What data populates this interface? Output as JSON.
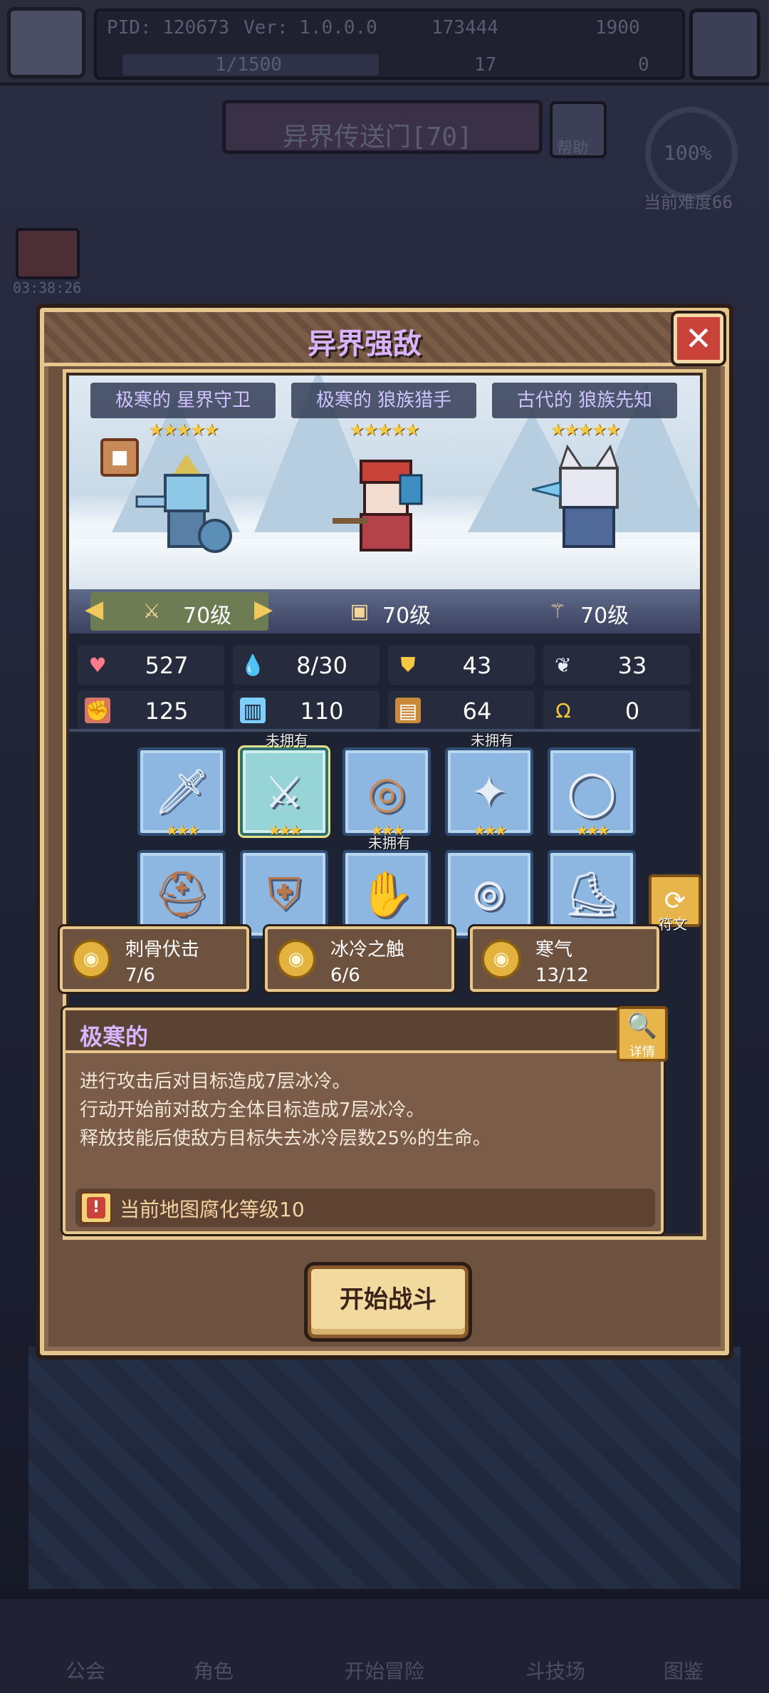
{
  "topbar": {
    "pid": "PID: 120673",
    "version": "Ver: 1.0.0.0",
    "currency1": "173444",
    "currency2": "1900",
    "exp": "1/1500",
    "item1": "17",
    "item2": "0"
  },
  "portal": {
    "title": "异界传送门[70]",
    "help": "帮助",
    "difficulty_pct": "100%",
    "difficulty_label": "当前难度66"
  },
  "timer": "03:38:26",
  "bottom_nav": [
    "公会",
    "角色",
    "开始冒险",
    "斗技场",
    "图鉴"
  ],
  "modal": {
    "title": "异界强敌",
    "close": "✕",
    "enemies": [
      {
        "name": "极寒的 星界守卫",
        "stars": "★★★★★",
        "level": "70级"
      },
      {
        "name": "极寒的 狼族猎手",
        "stars": "★★★★★",
        "level": "70级"
      },
      {
        "name": "古代的 狼族先知",
        "stars": "★★★★★",
        "level": "70级"
      }
    ],
    "stats": [
      {
        "icon": "heart-icon",
        "value": "527"
      },
      {
        "icon": "water-drop-icon",
        "value": "8/30"
      },
      {
        "icon": "shield-icon",
        "value": "43"
      },
      {
        "icon": "wing-icon",
        "value": "33"
      },
      {
        "icon": "fist-icon",
        "value": "125"
      },
      {
        "icon": "book-icon",
        "value": "110"
      },
      {
        "icon": "magic-armor-icon",
        "value": "64"
      },
      {
        "icon": "horseshoe-icon",
        "value": "0"
      }
    ],
    "equipment_unowned_tag": "未拥有",
    "equipment_stars": "★★★",
    "rune_label": "符文",
    "skills": [
      {
        "name": "刺骨伏击",
        "count": "7/6"
      },
      {
        "name": "冰冷之触",
        "count": "6/6"
      },
      {
        "name": "寒气",
        "count": "13/12"
      }
    ],
    "trait": {
      "title": "极寒的",
      "detail": "详情",
      "lines": [
        "进行攻击后对目标造成7层冰冷。",
        "行动开始前对敌方全体目标造成7层冰冷。",
        "释放技能后使敌方目标失去冰冷层数25%的生命。"
      ],
      "corruption": "当前地图腐化等级10"
    },
    "start_button": "开始战斗"
  }
}
